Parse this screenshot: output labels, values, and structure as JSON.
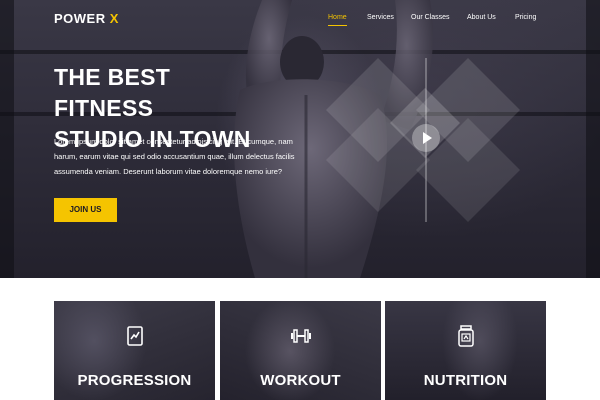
{
  "brand": {
    "name": "POWER",
    "accent": "X",
    "accent_color": "#f5c400"
  },
  "nav": {
    "items": [
      {
        "label": "Home",
        "active": true
      },
      {
        "label": "Services",
        "active": false
      },
      {
        "label": "Our Classes",
        "active": false
      },
      {
        "label": "About Us",
        "active": false
      },
      {
        "label": "Pricing",
        "active": false
      }
    ]
  },
  "hero": {
    "headline_line1": "THE BEST FITNESS",
    "headline_line2": "STUDIO IN TOWN",
    "intro": "Lorem ipsum dolor sit amet consectetur adipisicing elit. Et cumque, nam harum, earum vitae qui sed odio accusantium quae, illum delectus facilis assumenda veniam. Deserunt laborum vitae doloremque nemo iure?",
    "cta_label": "JOIN US",
    "play_icon": "play-icon"
  },
  "cards": [
    {
      "title": "PROGRESSION",
      "icon": "chart-icon"
    },
    {
      "title": "WORKOUT",
      "icon": "dumbbell-icon"
    },
    {
      "title": "NUTRITION",
      "icon": "supplement-jar-icon"
    }
  ],
  "colors": {
    "accent": "#f5c400",
    "hero_overlay": "#2d2b38"
  }
}
